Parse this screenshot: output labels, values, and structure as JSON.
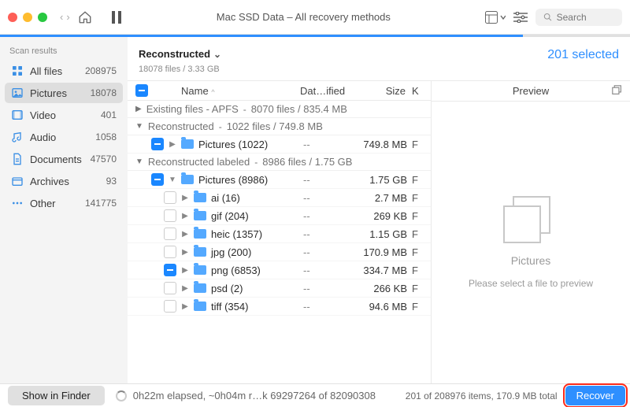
{
  "window": {
    "title": "Mac SSD Data – All recovery methods"
  },
  "search": {
    "placeholder": "Search"
  },
  "sidebar": {
    "header": "Scan results",
    "items": [
      {
        "label": "All files",
        "count": "208975"
      },
      {
        "label": "Pictures",
        "count": "18078"
      },
      {
        "label": "Video",
        "count": "401"
      },
      {
        "label": "Audio",
        "count": "1058"
      },
      {
        "label": "Documents",
        "count": "47570"
      },
      {
        "label": "Archives",
        "count": "93"
      },
      {
        "label": "Other",
        "count": "141775"
      }
    ]
  },
  "breadcrumb": {
    "title": "Reconstructed",
    "sub": "18078 files / 3.33 GB",
    "selected": "201 selected"
  },
  "columns": {
    "name": "Name",
    "date": "Dat…ified",
    "size": "Size",
    "kind": "K"
  },
  "groups": {
    "g0": {
      "label": "Existing files - APFS",
      "meta": "8070 files / 835.4 MB"
    },
    "g1": {
      "label": "Reconstructed",
      "meta": "1022 files / 749.8 MB"
    },
    "g2": {
      "label": "Reconstructed labeled",
      "meta": "8986 files / 1.75 GB"
    }
  },
  "rows": {
    "r1": {
      "name": "Pictures (1022)",
      "date": "--",
      "size": "749.8 MB",
      "k": "F"
    },
    "r2": {
      "name": "Pictures (8986)",
      "date": "--",
      "size": "1.75 GB",
      "k": "F"
    },
    "r3": {
      "name": "ai (16)",
      "date": "--",
      "size": "2.7 MB",
      "k": "F"
    },
    "r4": {
      "name": "gif (204)",
      "date": "--",
      "size": "269 KB",
      "k": "F"
    },
    "r5": {
      "name": "heic (1357)",
      "date": "--",
      "size": "1.15 GB",
      "k": "F"
    },
    "r6": {
      "name": "jpg (200)",
      "date": "--",
      "size": "170.9 MB",
      "k": "F"
    },
    "r7": {
      "name": "png (6853)",
      "date": "--",
      "size": "334.7 MB",
      "k": "F"
    },
    "r8": {
      "name": "psd (2)",
      "date": "--",
      "size": "266 KB",
      "k": "F"
    },
    "r9": {
      "name": "tiff (354)",
      "date": "--",
      "size": "94.6 MB",
      "k": "F"
    }
  },
  "preview": {
    "title": "Preview",
    "caption": "Pictures",
    "hint": "Please select a file to preview"
  },
  "footer": {
    "show": "Show in Finder",
    "progress": "0h22m elapsed, ~0h04m r…k 69297264 of 82090308",
    "stats": "201 of 208976 items, 170.9 MB total",
    "recover": "Recover"
  },
  "glyphs": {
    "dash": "--",
    "chevR": "›",
    "chevD": "⌄",
    "triR": "▶",
    "triD": "▼"
  }
}
